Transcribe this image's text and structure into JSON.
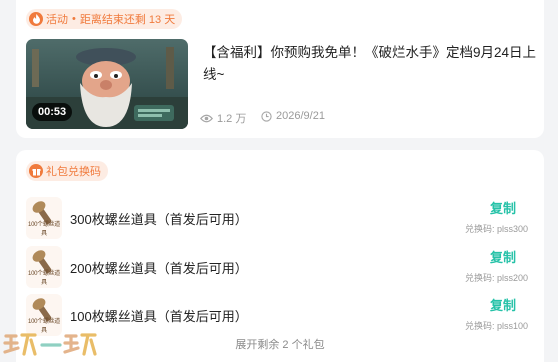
{
  "activity": {
    "tag_label": "活动",
    "tag_dot": "•",
    "countdown": "距离结束还剩 13 天",
    "video_duration": "00:53",
    "title": "【含福利】你预购我免单！《破烂水手》定档9月24日上线~",
    "views": "1.2 万",
    "date": "2026/9/21"
  },
  "gift": {
    "tag_label": "礼包兑换码",
    "icon_caption": "100个螺丝道具",
    "items": [
      {
        "name": "300枚螺丝道具（首发后可用）",
        "copy_label": "复制",
        "code_prefix": "兑换码:",
        "code": "plss300"
      },
      {
        "name": "200枚螺丝道具（首发后可用）",
        "copy_label": "复制",
        "code_prefix": "兑换码:",
        "code": "plss200"
      },
      {
        "name": "100枚螺丝道具（首发后可用）",
        "copy_label": "复制",
        "code_prefix": "兑换码:",
        "code": "plss100"
      }
    ],
    "expand_label": "展开剩余 2 个礼包"
  },
  "watermark": "玩一玩",
  "colors": {
    "accent_orange": "#f07a3c",
    "copy_teal": "#26c2a8"
  }
}
